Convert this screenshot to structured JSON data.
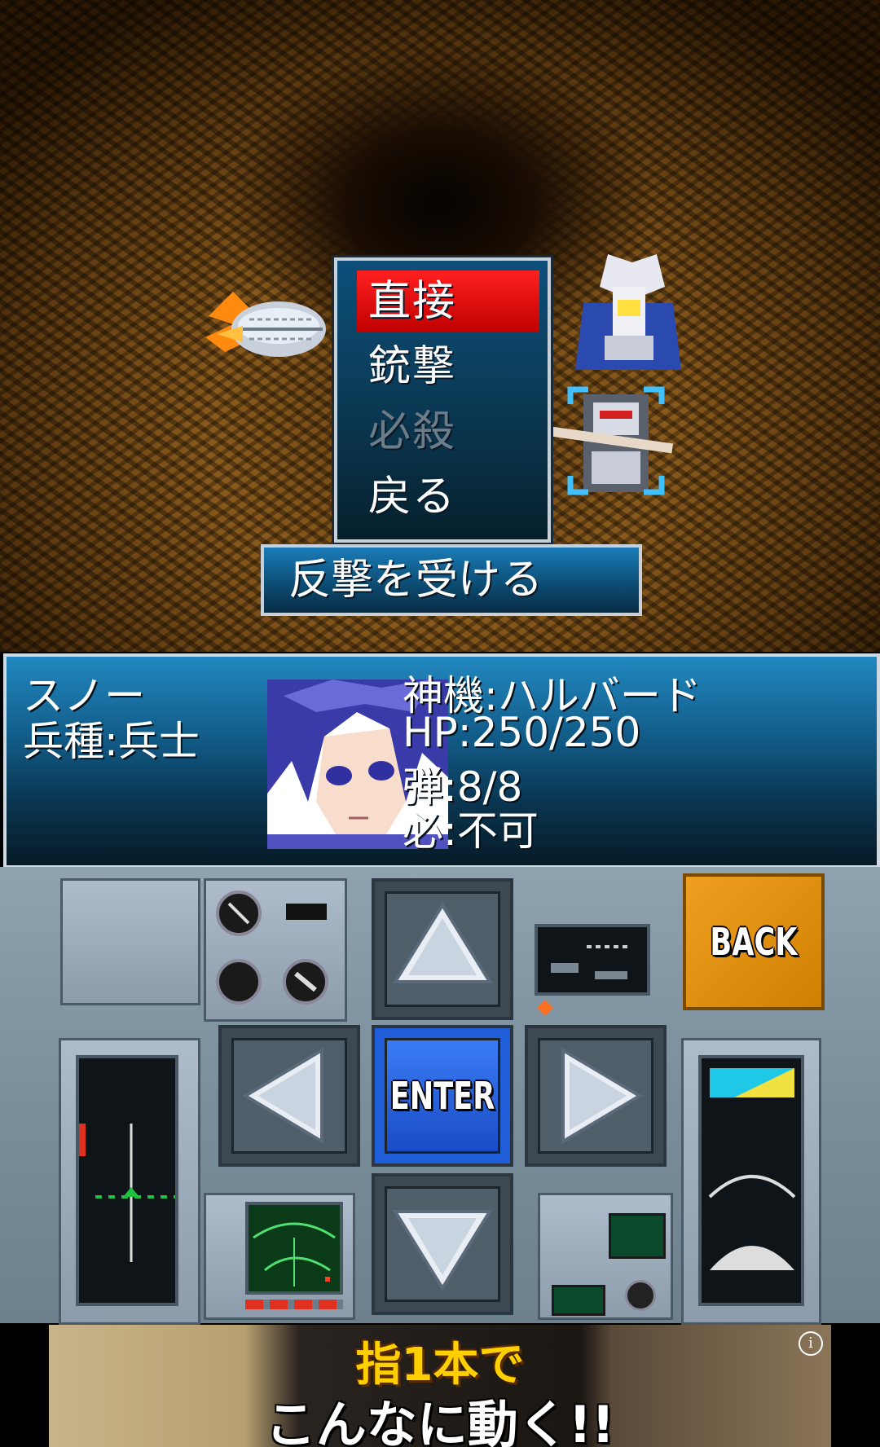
{
  "battle_menu": {
    "items": [
      {
        "label": "直接",
        "state": "selected"
      },
      {
        "label": "銃撃",
        "state": "enabled"
      },
      {
        "label": "必殺",
        "state": "disabled"
      },
      {
        "label": "戻る",
        "state": "enabled"
      }
    ],
    "counter_label": "反撃を受ける"
  },
  "unit": {
    "name": "スノー",
    "class": "兵種:兵士",
    "machine": "神機:ハルバード",
    "hp": "HP:250/250",
    "ammo": "弾:8/8",
    "special": "必:不可"
  },
  "controls": {
    "enter_label": "ENTER",
    "back_label": "BACK",
    "up_icon": "arrow-up-icon",
    "down_icon": "arrow-down-icon",
    "left_icon": "arrow-left-icon",
    "right_icon": "arrow-right-icon"
  },
  "ad": {
    "line1": "指1本で",
    "line2": "こんなに動く!!",
    "info_icon": "info-icon"
  },
  "colors": {
    "menu_selected": "#e00000",
    "panel_blue": "#115a86",
    "enter_blue": "#1f5ed8",
    "back_orange": "#e09010",
    "ad_yellow": "#ffd000"
  }
}
